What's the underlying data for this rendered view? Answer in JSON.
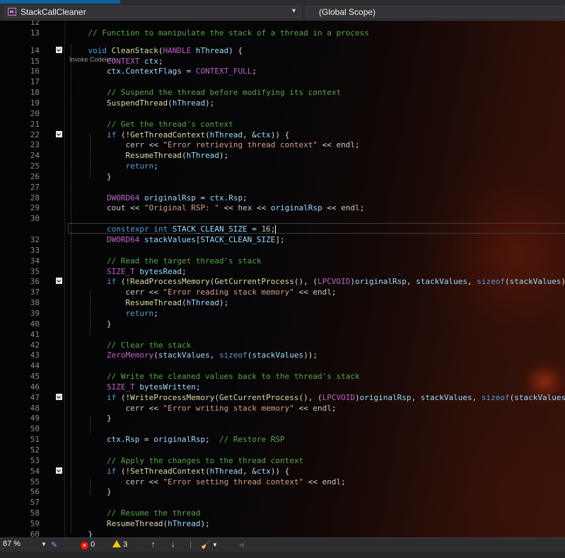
{
  "navbar": {
    "file_dropdown": "StackCallCleaner",
    "scope_dropdown": "(Global Scope)"
  },
  "editor": {
    "codelens": "Invoke Codeium",
    "lines": [
      {
        "n": "12",
        "tokens": []
      },
      {
        "n": "13",
        "tokens": [
          {
            "t": "    "
          },
          {
            "t": "// Function to manipulate the stack of a thread in a process",
            "c": "cm"
          }
        ]
      },
      {
        "n": "14",
        "fold": true,
        "tokens": [
          {
            "t": "    "
          },
          {
            "t": "void",
            "c": "kw"
          },
          {
            "t": " "
          },
          {
            "t": "CleanStack",
            "c": "fn"
          },
          {
            "t": "(",
            "c": "op"
          },
          {
            "t": "HANDLE",
            "c": "ma"
          },
          {
            "t": " "
          },
          {
            "t": "hThread",
            "c": "pa"
          },
          {
            "t": ") {",
            "c": "op"
          }
        ]
      },
      {
        "n": "15",
        "tokens": [
          {
            "t": "        "
          },
          {
            "t": "CONTEXT",
            "c": "ma"
          },
          {
            "t": " "
          },
          {
            "t": "ctx",
            "c": "lv"
          },
          {
            "t": ";",
            "c": "op"
          }
        ]
      },
      {
        "n": "16",
        "tokens": [
          {
            "t": "        "
          },
          {
            "t": "ctx",
            "c": "lv"
          },
          {
            "t": ".",
            "c": "op"
          },
          {
            "t": "ContextFlags",
            "c": "lv"
          },
          {
            "t": " = ",
            "c": "op"
          },
          {
            "t": "CONTEXT_FULL",
            "c": "ma"
          },
          {
            "t": ";",
            "c": "op"
          }
        ]
      },
      {
        "n": "17",
        "tokens": []
      },
      {
        "n": "18",
        "tokens": [
          {
            "t": "        "
          },
          {
            "t": "// Suspend the thread before modifying its context",
            "c": "cm"
          }
        ]
      },
      {
        "n": "19",
        "tokens": [
          {
            "t": "        "
          },
          {
            "t": "SuspendThread",
            "c": "fn"
          },
          {
            "t": "(",
            "c": "op"
          },
          {
            "t": "hThread",
            "c": "pa"
          },
          {
            "t": ");",
            "c": "op"
          }
        ]
      },
      {
        "n": "20",
        "tokens": []
      },
      {
        "n": "21",
        "tokens": [
          {
            "t": "        "
          },
          {
            "t": "// Get the thread's context",
            "c": "cm"
          }
        ]
      },
      {
        "n": "22",
        "fold": true,
        "tokens": [
          {
            "t": "        "
          },
          {
            "t": "if",
            "c": "kw"
          },
          {
            "t": " (!",
            "c": "op"
          },
          {
            "t": "GetThreadContext",
            "c": "fn"
          },
          {
            "t": "(",
            "c": "op"
          },
          {
            "t": "hThread",
            "c": "pa"
          },
          {
            "t": ", &",
            "c": "op"
          },
          {
            "t": "ctx",
            "c": "lv"
          },
          {
            "t": ")) {",
            "c": "op"
          }
        ]
      },
      {
        "n": "23",
        "tokens": [
          {
            "t": "            "
          },
          {
            "t": "cerr",
            "c": "dv"
          },
          {
            "t": " << ",
            "c": "op"
          },
          {
            "t": "\"Error retrieving thread context\"",
            "c": "st"
          },
          {
            "t": " << ",
            "c": "op"
          },
          {
            "t": "endl",
            "c": "dv"
          },
          {
            "t": ";",
            "c": "op"
          }
        ]
      },
      {
        "n": "24",
        "tokens": [
          {
            "t": "            "
          },
          {
            "t": "ResumeThread",
            "c": "fn"
          },
          {
            "t": "(",
            "c": "op"
          },
          {
            "t": "hThread",
            "c": "pa"
          },
          {
            "t": ");",
            "c": "op"
          }
        ]
      },
      {
        "n": "25",
        "tokens": [
          {
            "t": "            "
          },
          {
            "t": "return",
            "c": "kw"
          },
          {
            "t": ";",
            "c": "op"
          }
        ]
      },
      {
        "n": "26",
        "tokens": [
          {
            "t": "        "
          },
          {
            "t": "}",
            "c": "op"
          }
        ]
      },
      {
        "n": "27",
        "tokens": []
      },
      {
        "n": "28",
        "tokens": [
          {
            "t": "        "
          },
          {
            "t": "DWORD64",
            "c": "ma"
          },
          {
            "t": " "
          },
          {
            "t": "originalRsp",
            "c": "lv"
          },
          {
            "t": " = ",
            "c": "op"
          },
          {
            "t": "ctx",
            "c": "lv"
          },
          {
            "t": ".",
            "c": "op"
          },
          {
            "t": "Rsp",
            "c": "lv"
          },
          {
            "t": ";",
            "c": "op"
          }
        ]
      },
      {
        "n": "29",
        "tokens": [
          {
            "t": "        "
          },
          {
            "t": "cout",
            "c": "dv"
          },
          {
            "t": " << ",
            "c": "op"
          },
          {
            "t": "\"Original RSP: \"",
            "c": "st"
          },
          {
            "t": " << ",
            "c": "op"
          },
          {
            "t": "hex",
            "c": "dv"
          },
          {
            "t": " << ",
            "c": "op"
          },
          {
            "t": "originalRsp",
            "c": "lv"
          },
          {
            "t": " << ",
            "c": "op"
          },
          {
            "t": "endl",
            "c": "dv"
          },
          {
            "t": ";",
            "c": "op"
          }
        ]
      },
      {
        "n": "30",
        "tokens": []
      },
      {
        "n": "",
        "current": true,
        "tokens": [
          {
            "t": "        "
          },
          {
            "t": "constexpr",
            "c": "kw"
          },
          {
            "t": " "
          },
          {
            "t": "int",
            "c": "kw"
          },
          {
            "t": " "
          },
          {
            "t": "STACK_CLEAN_SIZE",
            "c": "lv"
          },
          {
            "t": " = ",
            "c": "op"
          },
          {
            "t": "16",
            "c": "nm"
          },
          {
            "t": ";",
            "c": "op"
          }
        ]
      },
      {
        "n": "32",
        "tokens": [
          {
            "t": "        "
          },
          {
            "t": "DWORD64",
            "c": "ma"
          },
          {
            "t": " "
          },
          {
            "t": "stackValues",
            "c": "lv"
          },
          {
            "t": "[",
            "c": "op"
          },
          {
            "t": "STACK_CLEAN_SIZE",
            "c": "lv"
          },
          {
            "t": "];",
            "c": "op"
          }
        ]
      },
      {
        "n": "33",
        "tokens": []
      },
      {
        "n": "34",
        "tokens": [
          {
            "t": "        "
          },
          {
            "t": "// Read the target thread's stack",
            "c": "cm"
          }
        ]
      },
      {
        "n": "35",
        "tokens": [
          {
            "t": "        "
          },
          {
            "t": "SIZE_T",
            "c": "ma"
          },
          {
            "t": " "
          },
          {
            "t": "bytesRead",
            "c": "lv"
          },
          {
            "t": ";",
            "c": "op"
          }
        ]
      },
      {
        "n": "36",
        "fold": true,
        "tokens": [
          {
            "t": "        "
          },
          {
            "t": "if",
            "c": "kw"
          },
          {
            "t": " (!",
            "c": "op"
          },
          {
            "t": "ReadProcessMemory",
            "c": "fn"
          },
          {
            "t": "(",
            "c": "op"
          },
          {
            "t": "GetCurrentProcess",
            "c": "fn"
          },
          {
            "t": "(), (",
            "c": "op"
          },
          {
            "t": "LPCVOID",
            "c": "ma"
          },
          {
            "t": ")",
            "c": "op"
          },
          {
            "t": "originalRsp",
            "c": "lv"
          },
          {
            "t": ", ",
            "c": "op"
          },
          {
            "t": "stackValues",
            "c": "lv"
          },
          {
            "t": ", ",
            "c": "op"
          },
          {
            "t": "sizeof",
            "c": "kw"
          },
          {
            "t": "(",
            "c": "op"
          },
          {
            "t": "stackValues",
            "c": "lv"
          },
          {
            "t": "), &b",
            "c": "op"
          }
        ]
      },
      {
        "n": "37",
        "tokens": [
          {
            "t": "            "
          },
          {
            "t": "cerr",
            "c": "dv"
          },
          {
            "t": " << ",
            "c": "op"
          },
          {
            "t": "\"Error reading stack memory\"",
            "c": "st"
          },
          {
            "t": " << ",
            "c": "op"
          },
          {
            "t": "endl",
            "c": "dv"
          },
          {
            "t": ";",
            "c": "op"
          }
        ]
      },
      {
        "n": "38",
        "tokens": [
          {
            "t": "            "
          },
          {
            "t": "ResumeThread",
            "c": "fn"
          },
          {
            "t": "(",
            "c": "op"
          },
          {
            "t": "hThread",
            "c": "pa"
          },
          {
            "t": ");",
            "c": "op"
          }
        ]
      },
      {
        "n": "39",
        "tokens": [
          {
            "t": "            "
          },
          {
            "t": "return",
            "c": "kw"
          },
          {
            "t": ";",
            "c": "op"
          }
        ]
      },
      {
        "n": "40",
        "tokens": [
          {
            "t": "        "
          },
          {
            "t": "}",
            "c": "op"
          }
        ]
      },
      {
        "n": "41",
        "tokens": []
      },
      {
        "n": "42",
        "tokens": [
          {
            "t": "        "
          },
          {
            "t": "// Clear the stack",
            "c": "cm"
          }
        ]
      },
      {
        "n": "43",
        "tokens": [
          {
            "t": "        "
          },
          {
            "t": "ZeroMemory",
            "c": "ma"
          },
          {
            "t": "(",
            "c": "op"
          },
          {
            "t": "stackValues",
            "c": "lv"
          },
          {
            "t": ", ",
            "c": "op"
          },
          {
            "t": "sizeof",
            "c": "kw"
          },
          {
            "t": "(",
            "c": "op"
          },
          {
            "t": "stackValues",
            "c": "lv"
          },
          {
            "t": "));",
            "c": "op"
          }
        ]
      },
      {
        "n": "44",
        "tokens": []
      },
      {
        "n": "45",
        "tokens": [
          {
            "t": "        "
          },
          {
            "t": "// Write the cleaned values back to the thread's stack",
            "c": "cm"
          }
        ]
      },
      {
        "n": "46",
        "tokens": [
          {
            "t": "        "
          },
          {
            "t": "SIZE_T",
            "c": "ma"
          },
          {
            "t": " "
          },
          {
            "t": "bytesWritten",
            "c": "lv"
          },
          {
            "t": ";",
            "c": "op"
          }
        ]
      },
      {
        "n": "47",
        "fold": true,
        "tokens": [
          {
            "t": "        "
          },
          {
            "t": "if",
            "c": "kw"
          },
          {
            "t": " (!",
            "c": "op"
          },
          {
            "t": "WriteProcessMemory",
            "c": "fn"
          },
          {
            "t": "(",
            "c": "op"
          },
          {
            "t": "GetCurrentProcess",
            "c": "fn"
          },
          {
            "t": "(), (",
            "c": "op"
          },
          {
            "t": "LPCVOID",
            "c": "ma"
          },
          {
            "t": ")",
            "c": "op"
          },
          {
            "t": "originalRsp",
            "c": "lv"
          },
          {
            "t": ", ",
            "c": "op"
          },
          {
            "t": "stackValues",
            "c": "lv"
          },
          {
            "t": ", ",
            "c": "op"
          },
          {
            "t": "sizeof",
            "c": "kw"
          },
          {
            "t": "(",
            "c": "op"
          },
          {
            "t": "stackValues",
            "c": "lv"
          },
          {
            "t": "), &b",
            "c": "op"
          }
        ]
      },
      {
        "n": "48",
        "tokens": [
          {
            "t": "            "
          },
          {
            "t": "cerr",
            "c": "dv"
          },
          {
            "t": " << ",
            "c": "op"
          },
          {
            "t": "\"Error writing stack memory\"",
            "c": "st"
          },
          {
            "t": " << ",
            "c": "op"
          },
          {
            "t": "endl",
            "c": "dv"
          },
          {
            "t": ";",
            "c": "op"
          }
        ]
      },
      {
        "n": "49",
        "tokens": [
          {
            "t": "        "
          },
          {
            "t": "}",
            "c": "op"
          }
        ]
      },
      {
        "n": "50",
        "tokens": []
      },
      {
        "n": "51",
        "tokens": [
          {
            "t": "        "
          },
          {
            "t": "ctx",
            "c": "lv"
          },
          {
            "t": ".",
            "c": "op"
          },
          {
            "t": "Rsp",
            "c": "lv"
          },
          {
            "t": " = ",
            "c": "op"
          },
          {
            "t": "originalRsp",
            "c": "lv"
          },
          {
            "t": ";  ",
            "c": "op"
          },
          {
            "t": "// Restore RSP",
            "c": "cm"
          }
        ]
      },
      {
        "n": "52",
        "tokens": []
      },
      {
        "n": "53",
        "tokens": [
          {
            "t": "        "
          },
          {
            "t": "// Apply the changes to the thread context",
            "c": "cm"
          }
        ]
      },
      {
        "n": "54",
        "fold": true,
        "tokens": [
          {
            "t": "        "
          },
          {
            "t": "if",
            "c": "kw"
          },
          {
            "t": " (!",
            "c": "op"
          },
          {
            "t": "SetThreadContext",
            "c": "fn"
          },
          {
            "t": "(",
            "c": "op"
          },
          {
            "t": "hThread",
            "c": "pa"
          },
          {
            "t": ", &",
            "c": "op"
          },
          {
            "t": "ctx",
            "c": "lv"
          },
          {
            "t": ")) {",
            "c": "op"
          }
        ]
      },
      {
        "n": "55",
        "tokens": [
          {
            "t": "            "
          },
          {
            "t": "cerr",
            "c": "dv"
          },
          {
            "t": " << ",
            "c": "op"
          },
          {
            "t": "\"Error setting thread context\"",
            "c": "st"
          },
          {
            "t": " << ",
            "c": "op"
          },
          {
            "t": "endl",
            "c": "dv"
          },
          {
            "t": ";",
            "c": "op"
          }
        ]
      },
      {
        "n": "56",
        "tokens": [
          {
            "t": "        "
          },
          {
            "t": "}",
            "c": "op"
          }
        ]
      },
      {
        "n": "57",
        "tokens": []
      },
      {
        "n": "58",
        "tokens": [
          {
            "t": "        "
          },
          {
            "t": "// Resume the thread",
            "c": "cm"
          }
        ]
      },
      {
        "n": "59",
        "tokens": [
          {
            "t": "        "
          },
          {
            "t": "ResumeThread",
            "c": "fn"
          },
          {
            "t": "(",
            "c": "op"
          },
          {
            "t": "hThread",
            "c": "pa"
          },
          {
            "t": ");",
            "c": "op"
          }
        ]
      },
      {
        "n": "60",
        "tokens": [
          {
            "t": "    "
          },
          {
            "t": "}",
            "c": "op"
          }
        ]
      }
    ]
  },
  "statusbar": {
    "zoom": "87 %",
    "errors": "0",
    "warnings": "3"
  },
  "colors": {
    "comment": "#57a64a",
    "keyword": "#569cd6",
    "function": "#dcdcaa",
    "macro": "#bd63c5",
    "string": "#d69d85",
    "variable": "#9cdcfe",
    "number": "#b5cea8"
  }
}
